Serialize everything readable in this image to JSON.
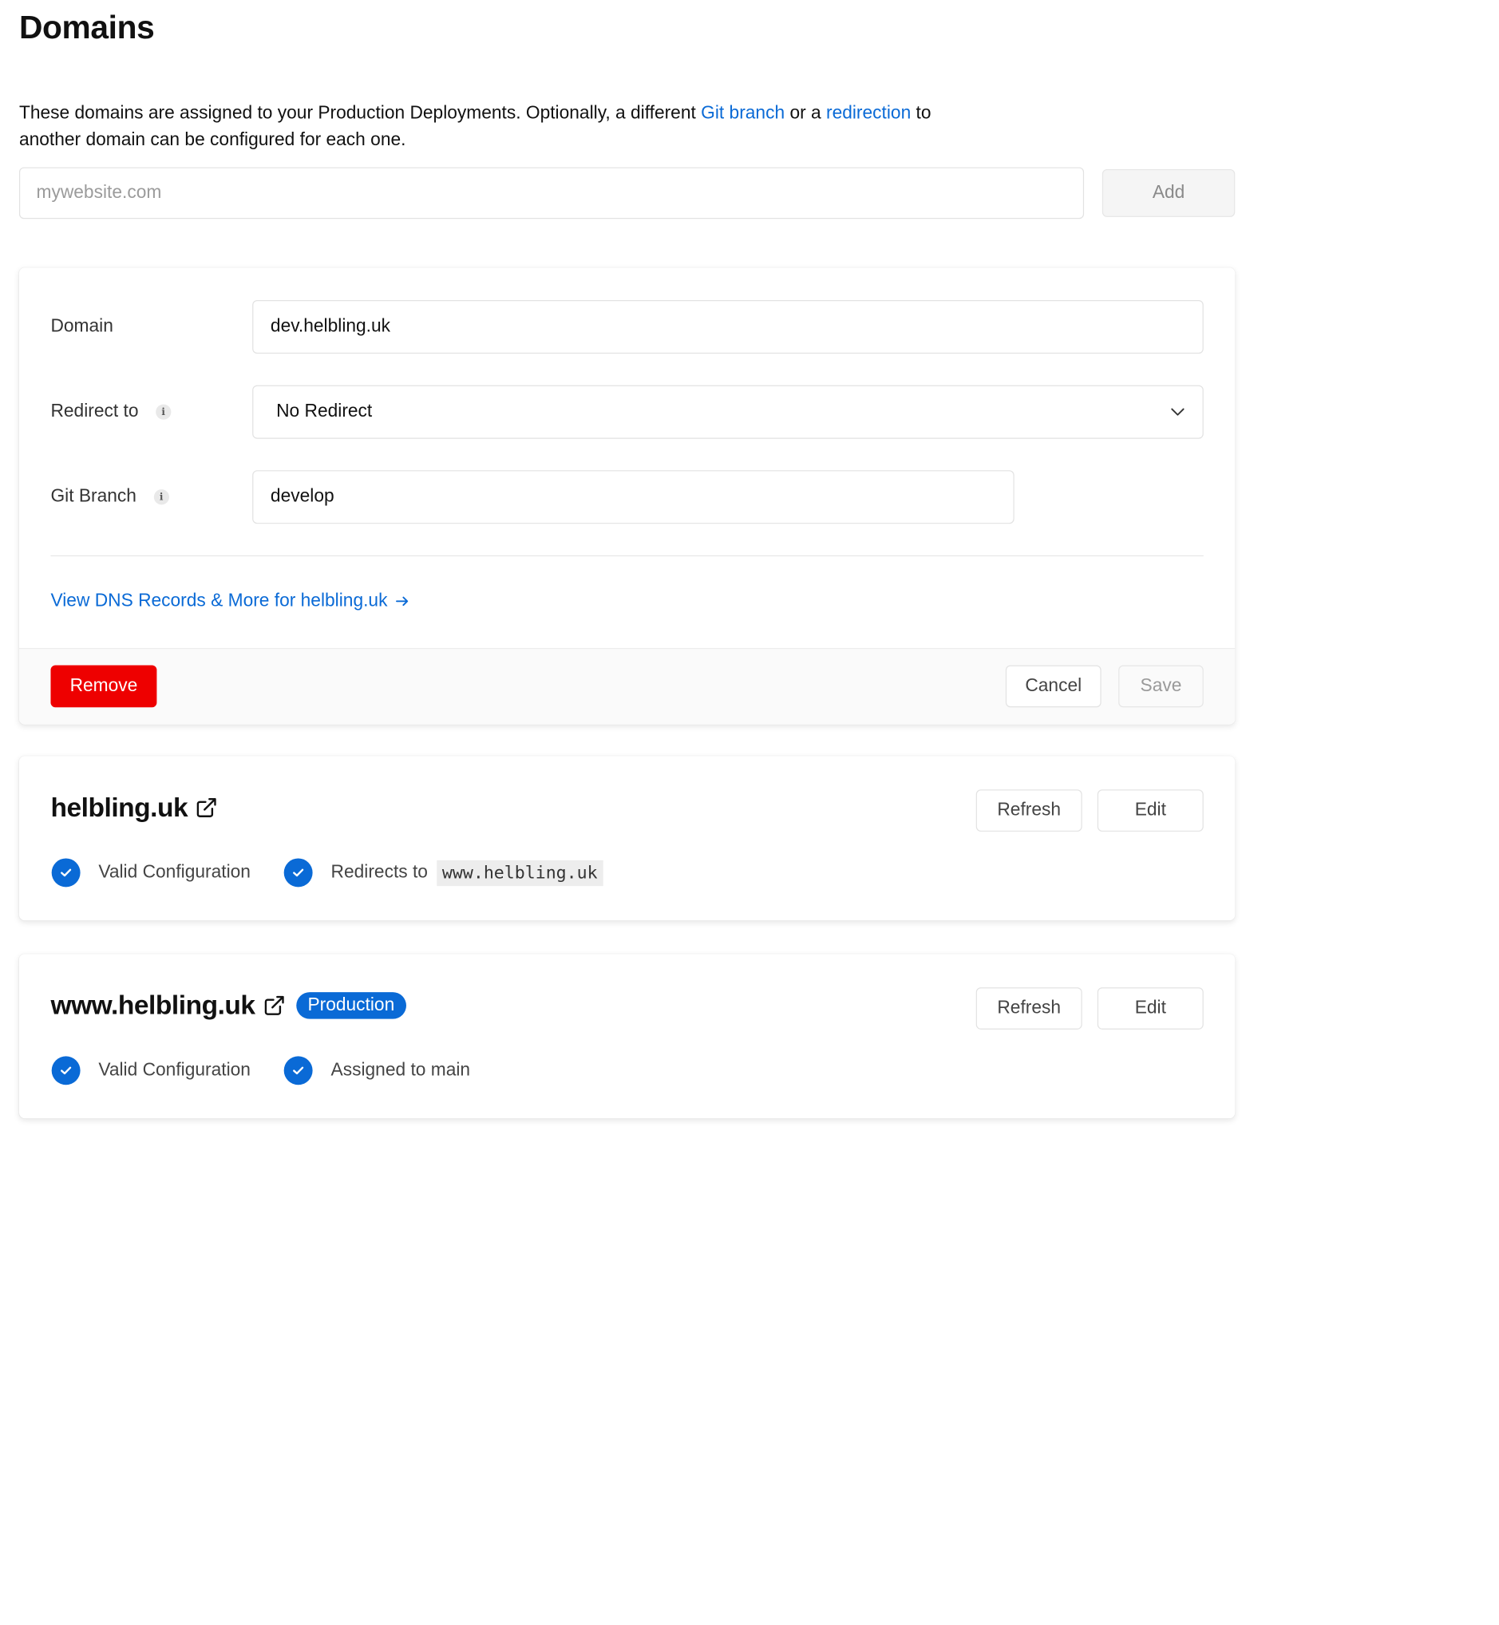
{
  "page": {
    "title": "Domains"
  },
  "intro": {
    "part1": "These domains are assigned to your Production Deployments. Optionally, a different ",
    "git_branch_link": "Git branch",
    "part2": " or a ",
    "redirection_link": "redirection",
    "part3": " to another domain can be configured for each one."
  },
  "add_domain": {
    "placeholder": "mywebsite.com",
    "button_label": "Add"
  },
  "edit_form": {
    "domain_label": "Domain",
    "domain_value": "dev.helbling.uk",
    "redirect_label": "Redirect to",
    "redirect_value": "No Redirect",
    "branch_label": "Git Branch",
    "branch_value": "develop",
    "dns_link": "View DNS Records & More for helbling.uk",
    "remove_label": "Remove",
    "cancel_label": "Cancel",
    "save_label": "Save"
  },
  "domains": [
    {
      "name": "helbling.uk",
      "badge": "",
      "refresh_label": "Refresh",
      "edit_label": "Edit",
      "status1": "Valid Configuration",
      "status2": "Redirects to",
      "status2_code": "www.helbling.uk"
    },
    {
      "name": "www.helbling.uk",
      "badge": "Production",
      "refresh_label": "Refresh",
      "edit_label": "Edit",
      "status1": "Valid Configuration",
      "status2": "Assigned to main"
    }
  ],
  "colors": {
    "accent": "#0a6ad6",
    "danger": "#ee0000"
  }
}
